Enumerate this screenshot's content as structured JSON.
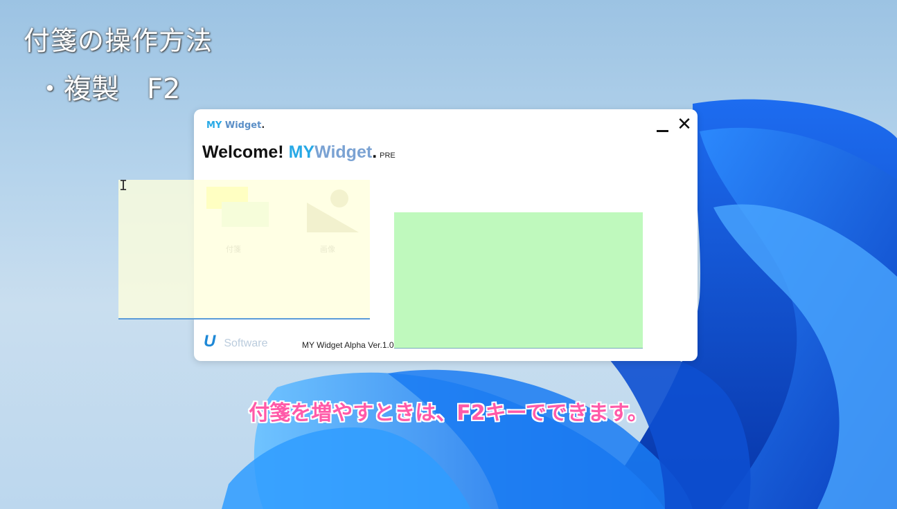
{
  "slide": {
    "title": "付箋の操作方法",
    "bullet": "・複製　F2"
  },
  "app": {
    "logo_my": "MY",
    "logo_widget": "Widget",
    "logo_dot": ".",
    "welcome_text": "Welcome!",
    "welcome_my": "MY",
    "welcome_widget": "Widget",
    "welcome_dot": ".",
    "welcome_badge": "PRE",
    "close_label": "✕",
    "menu": [
      {
        "label": "付箋",
        "icon": "sticky-note-icon"
      },
      {
        "label": "画像",
        "icon": "image-icon"
      }
    ],
    "footer_logo_mark": "U",
    "footer_logo_text": "Software",
    "version": "MY Widget Alpha Ver.1.0"
  },
  "subtitle": "付箋を増やすときは、F2キーでできます。",
  "colors": {
    "accent_blue": "#27a9e6",
    "sticky_yellow": "#ffffdc",
    "sticky_green": "#bff9bd",
    "subtitle_pink": "#ff5aa8"
  }
}
